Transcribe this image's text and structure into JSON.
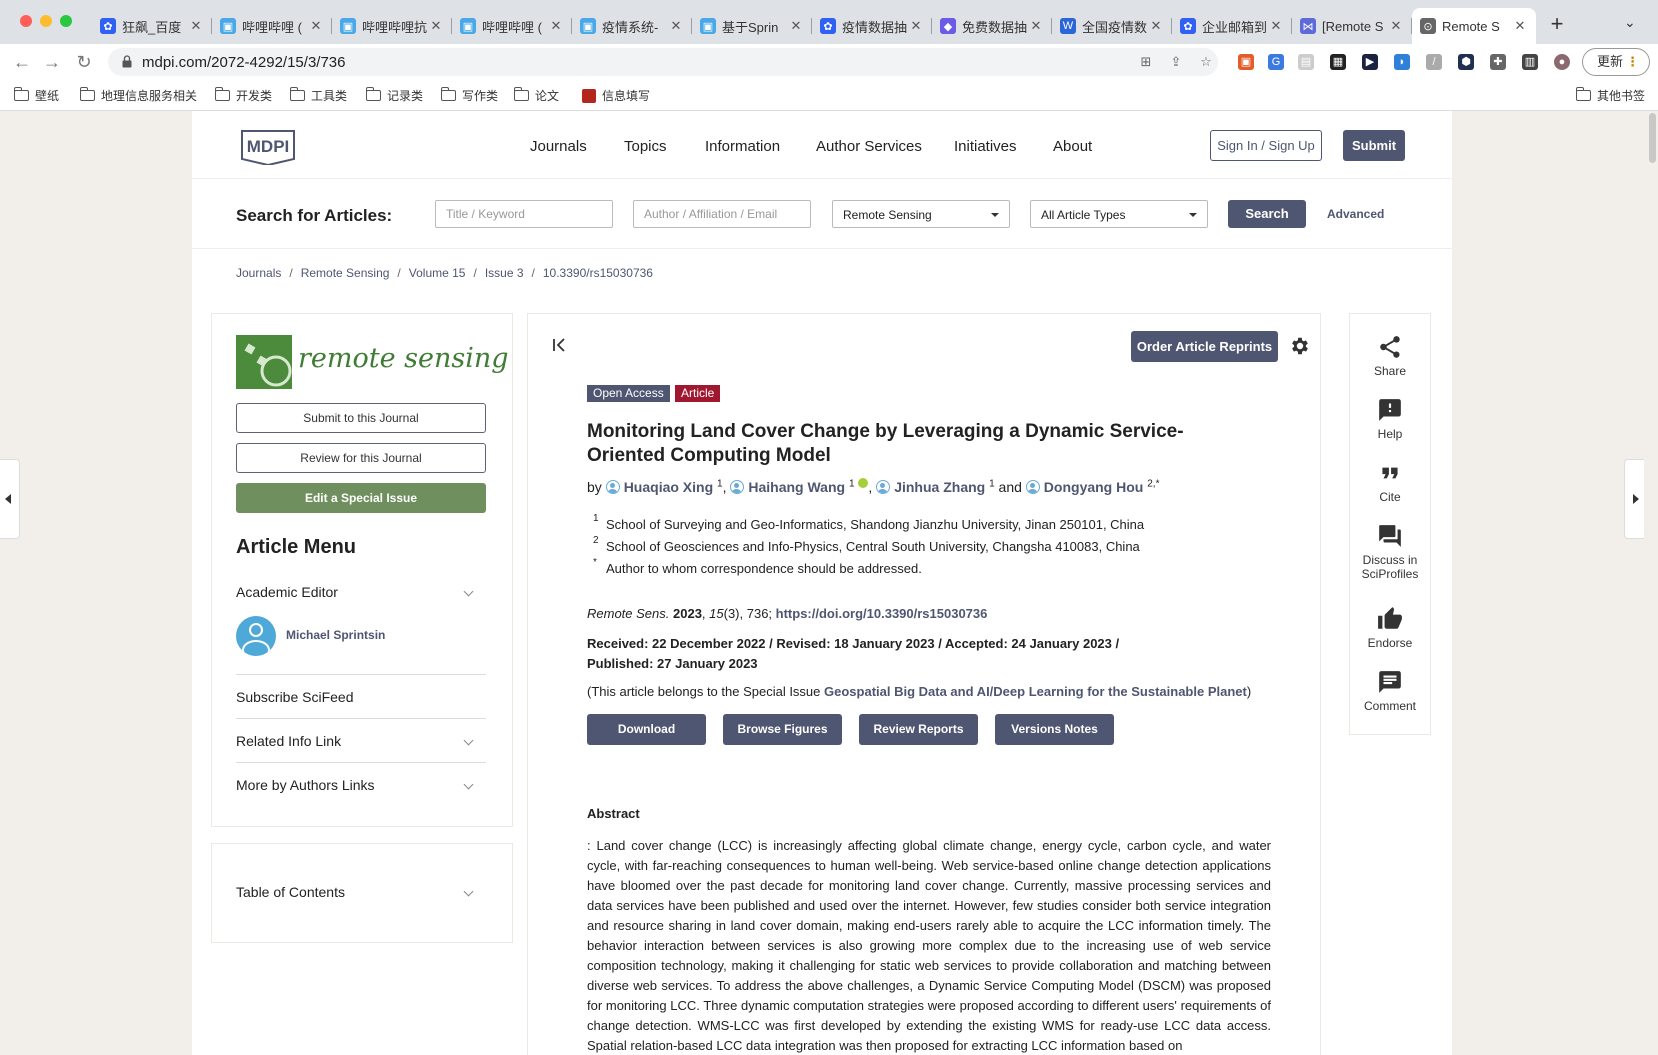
{
  "browser": {
    "tabs": [
      {
        "title": "狂飙_百度",
        "fav_color": "#3061f2",
        "fav_glyph": "✿"
      },
      {
        "title": "哔哩哔哩 (",
        "fav_color": "#4aa8e8",
        "fav_glyph": "▣"
      },
      {
        "title": "哔哩哔哩抗",
        "fav_color": "#4aa8e8",
        "fav_glyph": "▣"
      },
      {
        "title": "哔哩哔哩 (",
        "fav_color": "#4aa8e8",
        "fav_glyph": "▣"
      },
      {
        "title": "疫情系统-",
        "fav_color": "#4aa8e8",
        "fav_glyph": "▣"
      },
      {
        "title": "基于Sprin",
        "fav_color": "#4aa8e8",
        "fav_glyph": "▣"
      },
      {
        "title": "疫情数据抽",
        "fav_color": "#3061f2",
        "fav_glyph": "✿"
      },
      {
        "title": "免费数据抽",
        "fav_color": "#6b5be6",
        "fav_glyph": "◆"
      },
      {
        "title": "全国疫情数",
        "fav_color": "#2a66d8",
        "fav_glyph": "W"
      },
      {
        "title": "企业邮箱到",
        "fav_color": "#3061f2",
        "fav_glyph": "✿"
      },
      {
        "title": "[Remote S",
        "fav_color": "#5d6ad8",
        "fav_glyph": "⋈"
      },
      {
        "title": "Remote S",
        "fav_color": "#666666",
        "fav_glyph": "⊙"
      }
    ],
    "url": "mdpi.com/2072-4292/15/3/736",
    "update_label": "更新",
    "bookmarks": [
      {
        "label": "壁纸",
        "type": "folder"
      },
      {
        "label": "地理信息服务相关",
        "type": "folder"
      },
      {
        "label": "开发类",
        "type": "folder"
      },
      {
        "label": "工具类",
        "type": "folder"
      },
      {
        "label": "记录类",
        "type": "folder"
      },
      {
        "label": "写作类",
        "type": "folder"
      },
      {
        "label": "论文",
        "type": "folder"
      },
      {
        "label": "信息填写",
        "type": "link"
      }
    ],
    "other_bookmarks": "其他书签"
  },
  "header": {
    "logo_text": "MDPI",
    "nav": [
      "Journals",
      "Topics",
      "Information",
      "Author Services",
      "Initiatives",
      "About"
    ],
    "signin_label": "Sign In / Sign Up",
    "submit_label": "Submit"
  },
  "search": {
    "label": "Search for Articles:",
    "keyword_placeholder": "Title / Keyword",
    "author_placeholder": "Author / Affiliation / Email",
    "journal_value": "Remote Sensing",
    "type_value": "All Article Types",
    "search_label": "Search",
    "advanced_label": "Advanced"
  },
  "breadcrumb": [
    "Journals",
    "Remote Sensing",
    "Volume 15",
    "Issue 3",
    "10.3390/rs15030736"
  ],
  "sidebar": {
    "journal_name": "remote sensing",
    "submit_journal": "Submit to this Journal",
    "review_journal": "Review for this Journal",
    "edit_special": "Edit a Special Issue",
    "menu_title": "Article Menu",
    "academic_editor_label": "Academic Editor",
    "editor_name": "Michael Sprintsin",
    "subscribe": "Subscribe SciFeed",
    "related": "Related Info Link",
    "more_by": "More by Authors Links",
    "toc": "Table of Contents"
  },
  "article": {
    "reprints_label": "Order Article Reprints",
    "badge_open": "Open Access",
    "badge_type": "Article",
    "title": "Monitoring Land Cover Change by Leveraging a Dynamic Service-Oriented Computing Model",
    "by": "by",
    "authors": [
      {
        "name": "Huaqiao Xing",
        "sup": "1"
      },
      {
        "name": "Haihang Wang",
        "sup": "1"
      },
      {
        "name": "Jinhua Zhang",
        "sup": "1"
      },
      {
        "name": "Dongyang Hou",
        "sup": "2,*"
      }
    ],
    "and": "and",
    "affiliations": [
      {
        "mark": "1",
        "text": "School of Surveying and Geo-Informatics, Shandong Jianzhu University, Jinan 250101, China"
      },
      {
        "mark": "2",
        "text": "School of Geosciences and Info-Physics, Central South University, Changsha 410083, China"
      },
      {
        "mark": "*",
        "text": "Author to whom correspondence should be addressed."
      }
    ],
    "journal_abbr": "Remote Sens.",
    "year": "2023",
    "volume": "15",
    "issue_pages": "(3), 736; ",
    "doi": "https://doi.org/10.3390/rs15030736",
    "dates_line1": "Received: 22 December 2022 / Revised: 18 January 2023 / Accepted: 24 January 2023 /",
    "dates_line2": "Published: 27 January 2023",
    "special_prefix": "(This article belongs to the Special Issue ",
    "special_name": "Geospatial Big Data and AI/Deep Learning for the Sustainable Planet",
    "special_suffix": ")",
    "buttons": [
      "Download",
      "Browse Figures",
      "Review Reports",
      "Versions Notes"
    ],
    "abstract_heading": "Abstract",
    "abstract_text": ": Land cover change (LCC) is increasingly affecting global climate change, energy cycle, carbon cycle, and water cycle, with far-reaching consequences to human well-being. Web service-based online change detection applications have bloomed over the past decade for monitoring land cover change. Currently, massive processing services and data services have been published and used over the internet. However, few studies consider both service integration and resource sharing in land cover domain, making end-users rarely able to acquire the LCC information timely. The behavior interaction between services is also growing more complex due to the increasing use of web service composition technology, making it challenging for static web services to provide collaboration and matching between diverse web services. To address the above challenges, a Dynamic Service Computing Model (DSCM) was proposed for monitoring LCC. Three dynamic computation strategies were proposed according to different users' requirements of change detection. WMS-LCC was first developed by extending the existing WMS for ready-use LCC data access. Spatial relation-based LCC data integration was then proposed for extracting LCC information based on"
  },
  "rail": {
    "share": "Share",
    "help": "Help",
    "cite": "Cite",
    "discuss1": "Discuss in",
    "discuss2": "SciProfiles",
    "endorse": "Endorse",
    "comment": "Comment"
  },
  "colors": {
    "brand": "#4f5671",
    "article_badge": "#a01830",
    "special_green": "#6f8f5e",
    "journal_green": "#3f7c34"
  }
}
